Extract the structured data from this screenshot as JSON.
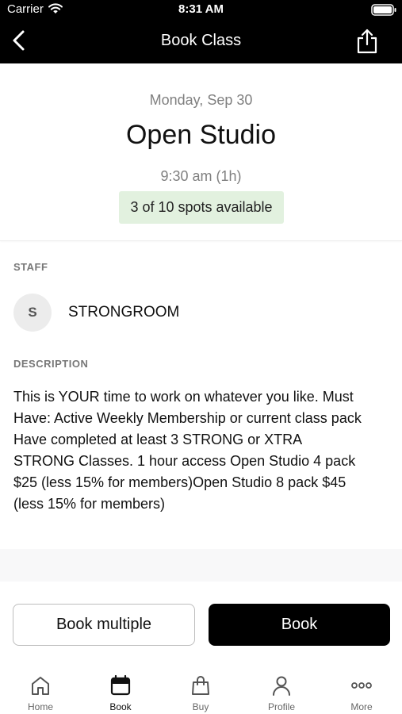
{
  "status_bar": {
    "carrier": "Carrier",
    "time": "8:31 AM"
  },
  "nav": {
    "title": "Book Class",
    "back_icon": "chevron-left-icon",
    "share_icon": "share-icon"
  },
  "class_info": {
    "date": "Monday, Sep 30",
    "name": "Open Studio",
    "time_duration": "9:30 am (1h)",
    "availability": "3 of 10 spots available",
    "availability_color": "#e2f1df"
  },
  "staff": {
    "label": "STAFF",
    "initial": "S",
    "name": "STRONGROOM"
  },
  "description": {
    "label": "DESCRIPTION",
    "text": "This is YOUR time to work on whatever you like. Must Have: Active Weekly Membership or current class pack Have completed at least 3 STRONG or XTRA STRONG Classes. 1 hour access Open Studio 4 pack $25 (less 15% for members)Open Studio 8 pack $45 (less 15% for members)"
  },
  "actions": {
    "book_multiple": "Book multiple",
    "book": "Book"
  },
  "tabbar": {
    "active": "Book",
    "items": [
      {
        "label": "Home",
        "icon": "home-icon"
      },
      {
        "label": "Book",
        "icon": "calendar-icon"
      },
      {
        "label": "Buy",
        "icon": "shopping-bag-icon"
      },
      {
        "label": "Profile",
        "icon": "person-icon"
      },
      {
        "label": "More",
        "icon": "more-dots-icon"
      }
    ]
  },
  "colors": {
    "nav_background": "#000000",
    "primary_button": "#000000",
    "muted_text": "#808080"
  }
}
